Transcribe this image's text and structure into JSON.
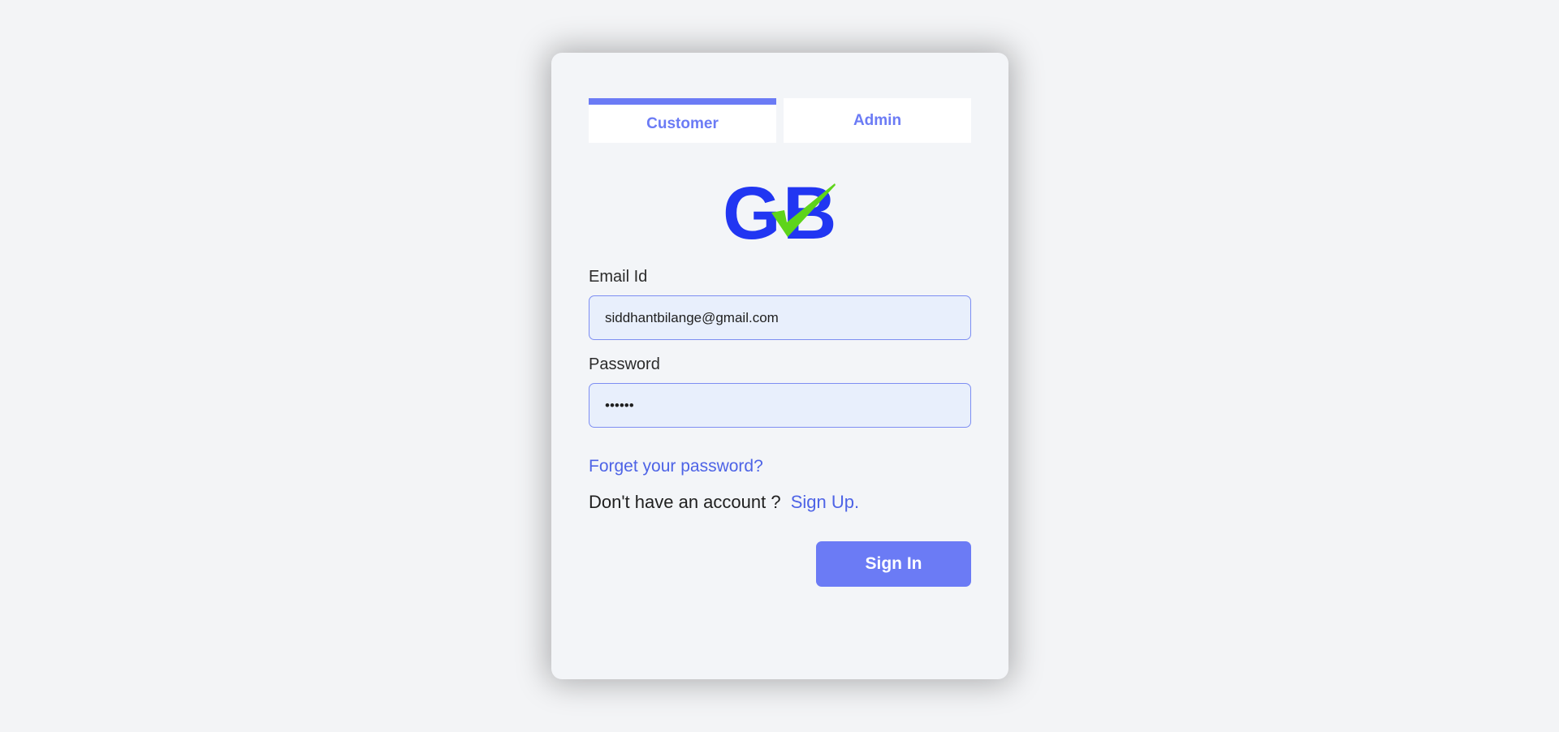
{
  "tabs": [
    {
      "label": "Customer",
      "active": true
    },
    {
      "label": "Admin",
      "active": false
    }
  ],
  "logo": {
    "text_left": "G",
    "text_right": "B",
    "mark_color": "#5ed41a",
    "text_color": "#2136f2"
  },
  "email": {
    "label": "Email Id",
    "value": "siddhantbilange@gmail.com"
  },
  "password": {
    "label": "Password",
    "value": "••••••"
  },
  "links": {
    "forget": "Forget your password?",
    "no_account": "Don't have an account ?",
    "signup": "Sign Up."
  },
  "signin_label": "Sign In",
  "colors": {
    "accent": "#6b7bf5",
    "link": "#4d63e6",
    "input_bg": "#e8effc"
  }
}
